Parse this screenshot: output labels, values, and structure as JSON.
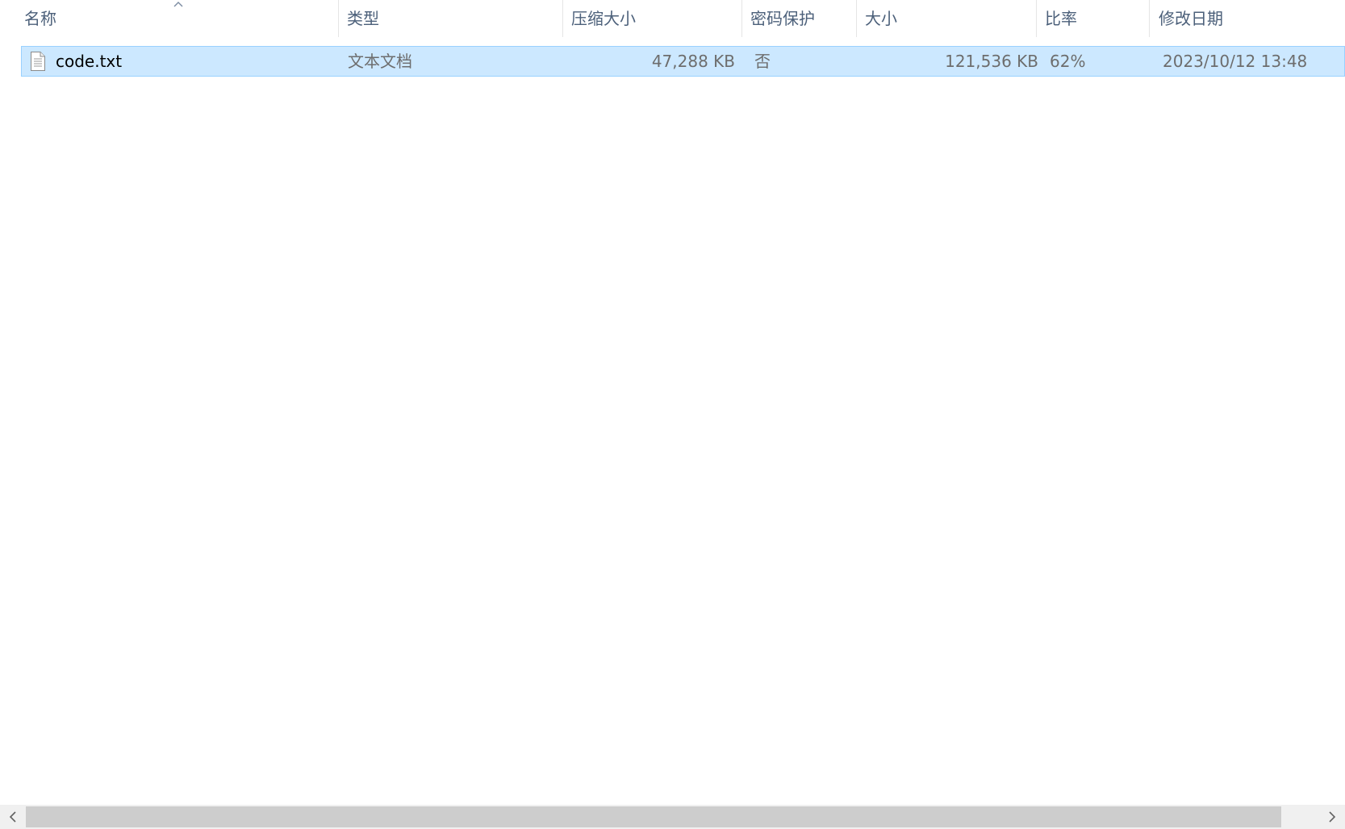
{
  "columns": {
    "name": "名称",
    "type": "类型",
    "compressed_size": "压缩大小",
    "password": "密码保护",
    "size": "大小",
    "ratio": "比率",
    "modified": "修改日期"
  },
  "sort": {
    "column": "名称",
    "icon": "chevron-up-icon"
  },
  "files": [
    {
      "icon": "text-file-icon",
      "name": "code.txt",
      "type": "文本文档",
      "compressed_size": "47,288 KB",
      "password": "否",
      "size": "121,536 KB",
      "ratio": "62%",
      "modified": "2023/10/12 13:48",
      "selected": true
    }
  ],
  "colors": {
    "selection_bg": "#cce8ff",
    "selection_border": "#99d1ff",
    "header_text": "#4c607a",
    "secondary_text": "#6d6d6d"
  }
}
